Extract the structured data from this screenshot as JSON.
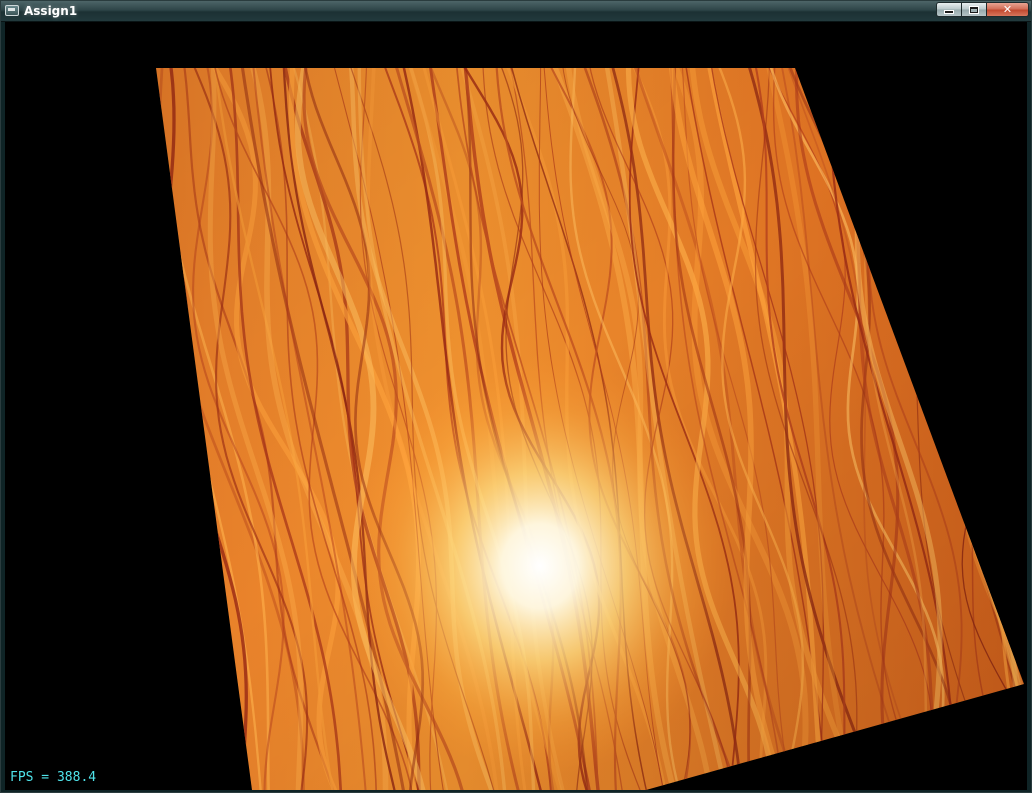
{
  "window": {
    "title": "Assign1",
    "controls": {
      "minimize": "minimize",
      "maximize": "maximize",
      "close": "✕"
    }
  },
  "scene": {
    "object": "textured-plane",
    "texture": "wood-grain-icon",
    "colors": {
      "background": "#000000",
      "wood_light": "#f28a2a",
      "wood_dark": "#b8361c",
      "specular": "#ffffff"
    }
  },
  "overlay": {
    "fps_text": "FPS = 388.4"
  }
}
